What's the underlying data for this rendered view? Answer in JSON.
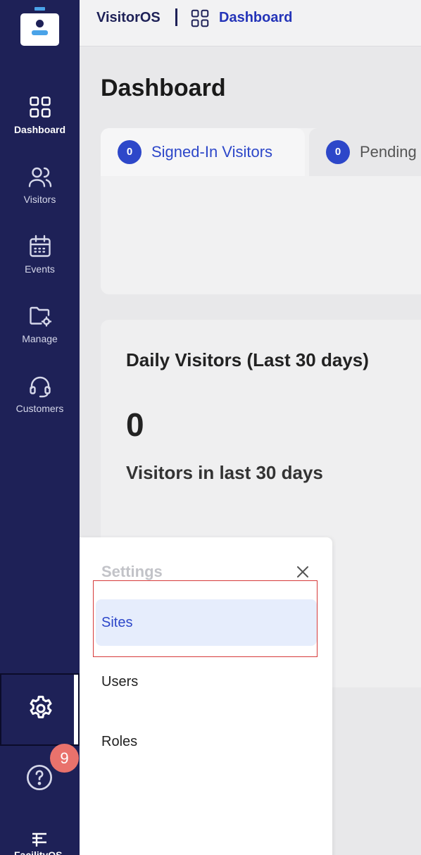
{
  "sidebar": {
    "items": [
      {
        "label": "Dashboard",
        "icon": "grid-icon",
        "active": true
      },
      {
        "label": "Visitors",
        "icon": "users-icon"
      },
      {
        "label": "Events",
        "icon": "calendar-icon"
      },
      {
        "label": "Manage",
        "icon": "folder-gear-icon"
      },
      {
        "label": "Customers",
        "icon": "headset-icon"
      }
    ],
    "help_badge": "9",
    "brand": "FacilityOS"
  },
  "topbar": {
    "app_name": "VisitorOS",
    "breadcrumb": "Dashboard"
  },
  "page": {
    "title": "Dashboard"
  },
  "tabs": [
    {
      "count": "0",
      "label": "Signed-In Visitors",
      "active": true
    },
    {
      "count": "0",
      "label": "Pending"
    }
  ],
  "daily": {
    "title": "Daily Visitors (Last 30 days)",
    "value": "0",
    "subtitle": "Visitors in last 30 days"
  },
  "settings_menu": {
    "title": "Settings",
    "items": [
      "Sites",
      "Users",
      "Roles"
    ]
  },
  "colors": {
    "sidebar_bg": "#1e2157",
    "accent": "#2d47c9",
    "badge": "#e9726c"
  }
}
